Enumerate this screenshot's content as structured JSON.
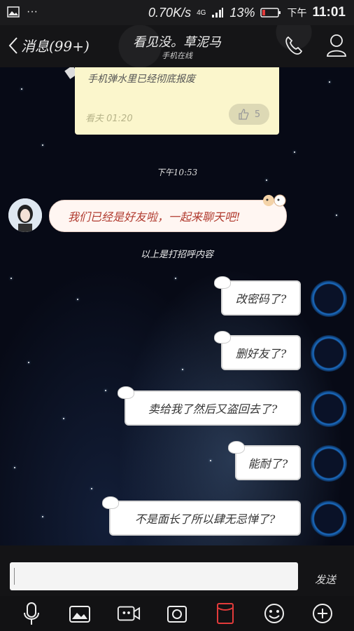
{
  "status_bar": {
    "network_speed": "0.70K/s",
    "signal": "4G",
    "battery": "13%",
    "ampm": "下午",
    "time": "11:01"
  },
  "nav": {
    "back_label": "消息(99+)",
    "title": "看见没。草泥马",
    "subtitle": "手机在线"
  },
  "pinned_note": {
    "text": "手机弹水里已经彻底报废",
    "meta": "看夫 01:20",
    "likes": "5"
  },
  "timestamp": "下午10:53",
  "friend_message": "我们已经是好友啦，一起来聊天吧!",
  "system_note": "以上是打招呼内容",
  "my_messages": [
    "改密码了?",
    "删好友了?",
    "卖给我了然后又盗回去了?",
    "能耐了?",
    "不是面长了所以肆无忌惮了?"
  ],
  "composer": {
    "send_label": "发送"
  },
  "toolbar": [
    "microphone-icon",
    "image-icon",
    "video-icon",
    "camera-icon",
    "red-packet-icon",
    "emoji-icon",
    "plus-icon"
  ],
  "colors": {
    "friend_text": "#b03a2e",
    "note_bg": "#fbf6cc",
    "avatar_ring": "#1b6fc7"
  }
}
